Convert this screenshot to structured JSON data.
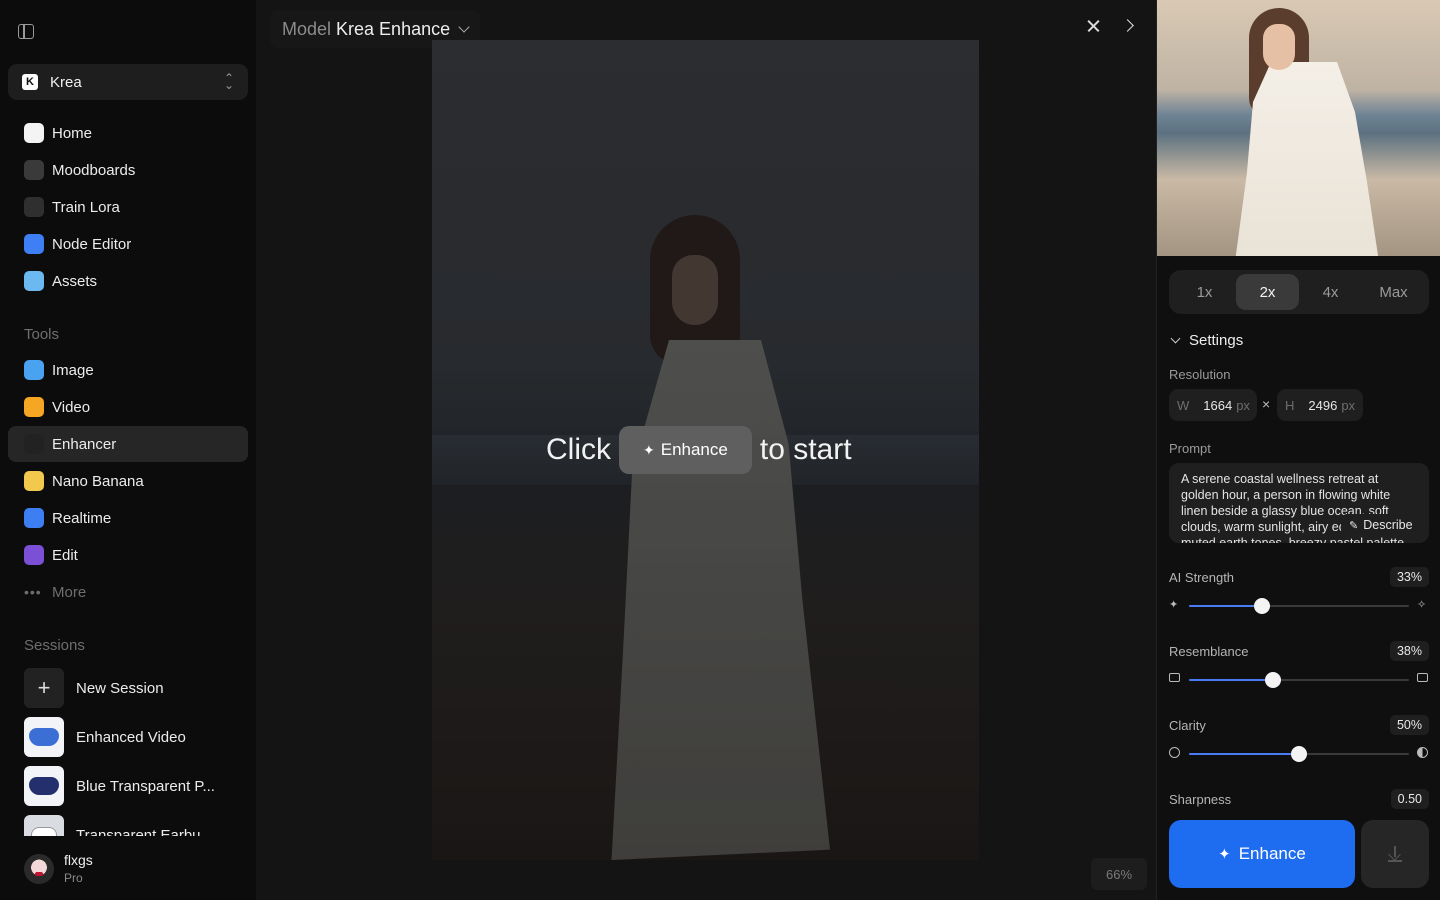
{
  "sidebar": {
    "workspace": "Krea",
    "nav": [
      {
        "label": "Home",
        "icon": "home-icon",
        "color": "#f4f4f4"
      },
      {
        "label": "Moodboards",
        "icon": "moodboards-icon",
        "color": "#3a3a3a"
      },
      {
        "label": "Train Lora",
        "icon": "train-lora-icon",
        "color": "#2f2f2f"
      },
      {
        "label": "Node Editor",
        "icon": "node-editor-icon",
        "color": "#3e7ff5"
      },
      {
        "label": "Assets",
        "icon": "folder-icon",
        "color": "#6cb8f0"
      }
    ],
    "tools_title": "Tools",
    "tools": [
      {
        "label": "Image",
        "icon": "image-icon",
        "color": "#4aa3f0"
      },
      {
        "label": "Video",
        "icon": "video-icon",
        "color": "#f5a623"
      },
      {
        "label": "Enhancer",
        "icon": "enhancer-icon",
        "color": "#222222",
        "active": true
      },
      {
        "label": "Nano Banana",
        "icon": "banana-icon",
        "color": "#f2c94c"
      },
      {
        "label": "Realtime",
        "icon": "realtime-icon",
        "color": "#3d7ff2"
      },
      {
        "label": "Edit",
        "icon": "edit-icon",
        "color": "#7b4fd6"
      }
    ],
    "more_label": "More",
    "sessions_title": "Sessions",
    "sessions": [
      {
        "label": "New Session"
      },
      {
        "label": "Enhanced Video"
      },
      {
        "label": "Blue Transparent P..."
      },
      {
        "label": "Transparent Earbu..."
      }
    ],
    "user": {
      "name": "flxgs",
      "plan": "Pro"
    }
  },
  "canvas": {
    "model_prefix": "Model",
    "model_name": "Krea Enhance",
    "start_before": "Click",
    "start_button": "Enhance",
    "start_after": "to start",
    "zoom": "66%"
  },
  "panel": {
    "scales": [
      "1x",
      "2x",
      "4x",
      "Max"
    ],
    "active_scale": "2x",
    "settings_label": "Settings",
    "resolution_label": "Resolution",
    "width_prefix": "W",
    "width": "1664",
    "height_prefix": "H",
    "height": "2496",
    "unit": "px",
    "times": "×",
    "prompt_label": "Prompt",
    "prompt": "A serene coastal wellness retreat at golden hour, a person in flowing white linen beside a glassy blue ocean, soft clouds, warm sunlight, airy editorial p... muted earth tones, breezy pastel palette",
    "describe_label": "Describe",
    "sliders": [
      {
        "name": "AI Strength",
        "value": "33%",
        "level": 0.33
      },
      {
        "name": "Resemblance",
        "value": "38%",
        "level": 0.38
      },
      {
        "name": "Clarity",
        "value": "50%",
        "level": 0.5
      }
    ],
    "sharpness_label": "Sharpness",
    "sharpness_value": "0.50",
    "enhance_label": "Enhance",
    "accent": "#1e6cf0"
  }
}
